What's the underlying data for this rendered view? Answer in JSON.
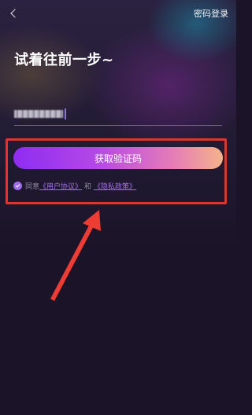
{
  "header": {
    "back_icon": "chevron-left-icon",
    "password_login_label": "密码登录"
  },
  "main": {
    "title": "试着往前一步~",
    "phone_field": {
      "value_masked": true
    },
    "get_code_button_label": "获取验证码",
    "agreement": {
      "prefix": "同意",
      "user_agreement_link": "《用户协议》",
      "conjunction": "和",
      "privacy_policy_link": "《隐私政策》",
      "checked": true
    }
  },
  "annotation": {
    "highlight_color": "#e4322c",
    "arrow_color": "#ee3b34"
  },
  "colors": {
    "accent_purple": "#8e2cf2",
    "accent_peach": "#f4b38a",
    "link_purple": "#a46cf0",
    "background": "#1b1428"
  }
}
